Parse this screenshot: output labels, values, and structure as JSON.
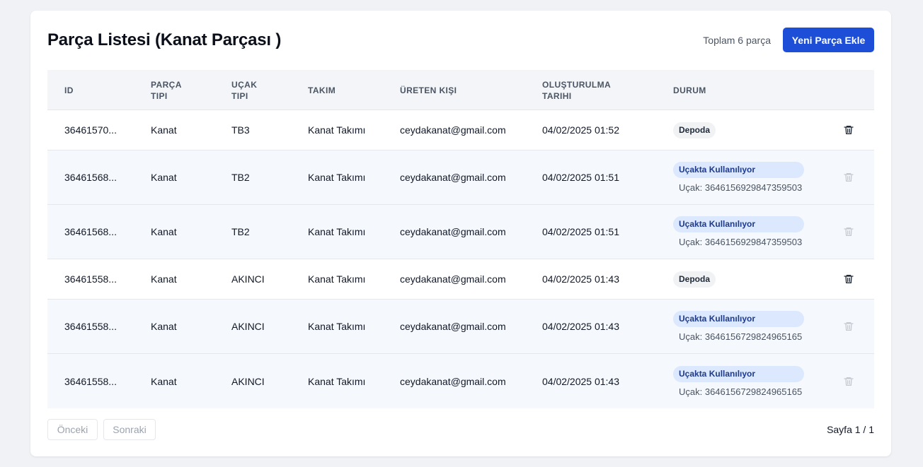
{
  "header": {
    "title": "Parça Listesi (Kanat Parçası )",
    "total_text": "Toplam 6 parça",
    "add_button": "Yeni Parça Ekle"
  },
  "table": {
    "columns": {
      "id": "ID",
      "type": "PARÇA TIPI",
      "plane": "UÇAK TIPI",
      "team": "TAKIM",
      "user": "ÜRETEN KIŞI",
      "date": "OLUŞTURULMA TARIHI",
      "status": "DURUM"
    },
    "rows": [
      {
        "id": "36461570...",
        "type": "Kanat",
        "plane": "TB3",
        "team": "Kanat Takımı",
        "user": "ceydakanat@gmail.com",
        "date": "04/02/2025 01:52",
        "status": "Depoda",
        "plane_ref": ""
      },
      {
        "id": "36461568...",
        "type": "Kanat",
        "plane": "TB2",
        "team": "Kanat Takımı",
        "user": "ceydakanat@gmail.com",
        "date": "04/02/2025 01:51",
        "status": "Uçakta Kullanılıyor",
        "plane_ref": "Uçak: 3646156929847359503"
      },
      {
        "id": "36461568...",
        "type": "Kanat",
        "plane": "TB2",
        "team": "Kanat Takımı",
        "user": "ceydakanat@gmail.com",
        "date": "04/02/2025 01:51",
        "status": "Uçakta Kullanılıyor",
        "plane_ref": "Uçak: 3646156929847359503"
      },
      {
        "id": "36461558...",
        "type": "Kanat",
        "plane": "AKINCI",
        "team": "Kanat Takımı",
        "user": "ceydakanat@gmail.com",
        "date": "04/02/2025 01:43",
        "status": "Depoda",
        "plane_ref": ""
      },
      {
        "id": "36461558...",
        "type": "Kanat",
        "plane": "AKINCI",
        "team": "Kanat Takımı",
        "user": "ceydakanat@gmail.com",
        "date": "04/02/2025 01:43",
        "status": "Uçakta Kullanılıyor",
        "plane_ref": "Uçak: 3646156729824965165"
      },
      {
        "id": "36461558...",
        "type": "Kanat",
        "plane": "AKINCI",
        "team": "Kanat Takımı",
        "user": "ceydakanat@gmail.com",
        "date": "04/02/2025 01:43",
        "status": "Uçakta Kullanılıyor",
        "plane_ref": "Uçak: 3646156729824965165"
      }
    ]
  },
  "pagination": {
    "prev": "Önceki",
    "next": "Sonraki",
    "page_info": "Sayfa 1 / 1"
  },
  "colors": {
    "accent": "#1d4ed8",
    "used_badge_bg": "#dbe8fd",
    "stock_badge_bg": "#f1f2f4"
  },
  "icons": {
    "delete": "trash-icon"
  }
}
